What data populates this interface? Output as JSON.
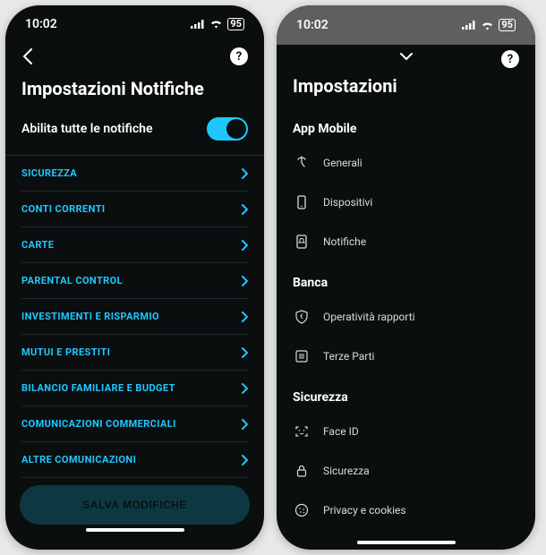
{
  "status": {
    "time": "10:02",
    "battery": "95"
  },
  "left": {
    "title": "Impostazioni Notifiche",
    "enable_label": "Abilita tutte le notifiche",
    "enabled": true,
    "categories": [
      "SICUREZZA",
      "CONTI CORRENTI",
      "CARTE",
      "PARENTAL CONTROL",
      "INVESTIMENTI E RISPARMIO",
      "MUTUI E PRESTITI",
      "BILANCIO FAMILIARE E BUDGET",
      "COMUNICAZIONI COMMERCIALI",
      "ALTRE COMUNICAZIONI"
    ],
    "save_label": "SALVA MODIFICHE"
  },
  "right": {
    "title": "Impostazioni",
    "sections": [
      {
        "name": "App Mobile",
        "items": [
          {
            "icon": "tap-icon",
            "label": "Generali"
          },
          {
            "icon": "device-icon",
            "label": "Dispositivi"
          },
          {
            "icon": "bell-icon",
            "label": "Notifiche"
          }
        ]
      },
      {
        "name": "Banca",
        "items": [
          {
            "icon": "shield-euro-icon",
            "label": "Operatività rapporti"
          },
          {
            "icon": "list-icon",
            "label": "Terze Parti"
          }
        ]
      },
      {
        "name": "Sicurezza",
        "items": [
          {
            "icon": "faceid-icon",
            "label": "Face ID"
          },
          {
            "icon": "lock-icon",
            "label": "Sicurezza"
          },
          {
            "icon": "cookie-icon",
            "label": "Privacy e cookies"
          }
        ]
      }
    ]
  }
}
